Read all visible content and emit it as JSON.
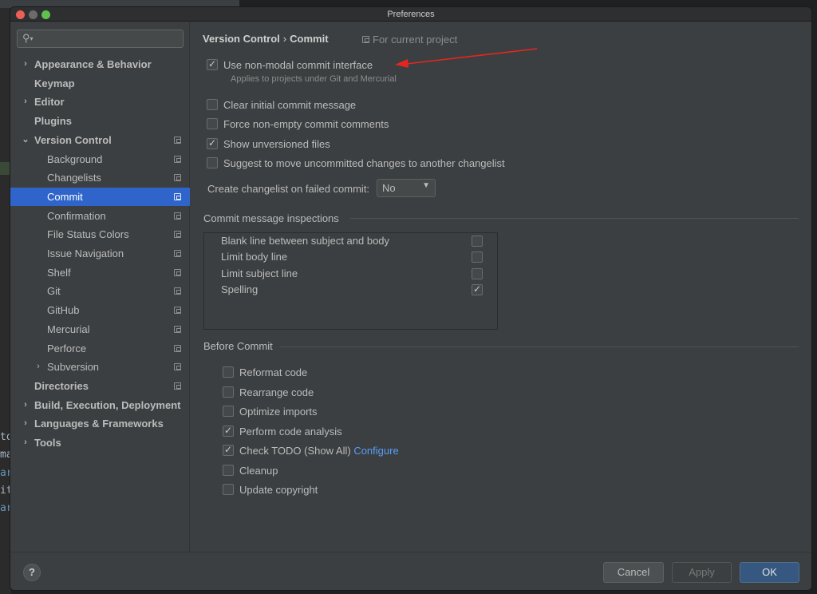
{
  "window": {
    "title": "Preferences"
  },
  "background_ide": {
    "lines": [
      {
        "text": "to",
        "blue": false
      },
      {
        "text": "ma",
        "blue": false
      },
      {
        "text": "ar",
        "blue": true
      },
      {
        "text": "it",
        "blue": false
      },
      {
        "text": "ar",
        "blue": true
      }
    ]
  },
  "sidebar": {
    "search_placeholder": "",
    "items": [
      {
        "label": "Appearance & Behavior",
        "bold": true,
        "arrow": "›",
        "indent": 0,
        "project_icon": false
      },
      {
        "label": "Keymap",
        "bold": true,
        "arrow": "",
        "indent": 0,
        "project_icon": false
      },
      {
        "label": "Editor",
        "bold": true,
        "arrow": "›",
        "indent": 0,
        "project_icon": false
      },
      {
        "label": "Plugins",
        "bold": true,
        "arrow": "",
        "indent": 0,
        "project_icon": false
      },
      {
        "label": "Version Control",
        "bold": true,
        "arrow": "⌄",
        "indent": 0,
        "project_icon": true
      },
      {
        "label": "Background",
        "bold": false,
        "arrow": "",
        "indent": 1,
        "project_icon": true
      },
      {
        "label": "Changelists",
        "bold": false,
        "arrow": "",
        "indent": 1,
        "project_icon": true
      },
      {
        "label": "Commit",
        "bold": false,
        "arrow": "",
        "indent": 1,
        "project_icon": true,
        "selected": true
      },
      {
        "label": "Confirmation",
        "bold": false,
        "arrow": "",
        "indent": 1,
        "project_icon": true
      },
      {
        "label": "File Status Colors",
        "bold": false,
        "arrow": "",
        "indent": 1,
        "project_icon": true
      },
      {
        "label": "Issue Navigation",
        "bold": false,
        "arrow": "",
        "indent": 1,
        "project_icon": true
      },
      {
        "label": "Shelf",
        "bold": false,
        "arrow": "",
        "indent": 1,
        "project_icon": true
      },
      {
        "label": "Git",
        "bold": false,
        "arrow": "",
        "indent": 1,
        "project_icon": true
      },
      {
        "label": "GitHub",
        "bold": false,
        "arrow": "",
        "indent": 1,
        "project_icon": true
      },
      {
        "label": "Mercurial",
        "bold": false,
        "arrow": "",
        "indent": 1,
        "project_icon": true
      },
      {
        "label": "Perforce",
        "bold": false,
        "arrow": "",
        "indent": 1,
        "project_icon": true
      },
      {
        "label": "Subversion",
        "bold": false,
        "arrow": "›",
        "indent": 1,
        "project_icon": true
      },
      {
        "label": "Directories",
        "bold": true,
        "arrow": "",
        "indent": 0,
        "project_icon": true
      },
      {
        "label": "Build, Execution, Deployment",
        "bold": true,
        "arrow": "›",
        "indent": 0,
        "project_icon": false
      },
      {
        "label": "Languages & Frameworks",
        "bold": true,
        "arrow": "›",
        "indent": 0,
        "project_icon": false
      },
      {
        "label": "Tools",
        "bold": true,
        "arrow": "›",
        "indent": 0,
        "project_icon": false
      }
    ]
  },
  "breadcrumb": {
    "parent": "Version Control",
    "separator": "›",
    "current": "Commit"
  },
  "scope_label": "For current project",
  "options": {
    "non_modal": {
      "label": "Use non-modal commit interface",
      "checked": true,
      "hint": "Applies to projects under Git and Mercurial"
    },
    "clear_initial": {
      "label": "Clear initial commit message",
      "checked": false
    },
    "force_nonempty": {
      "label": "Force non-empty commit comments",
      "checked": false
    },
    "show_unversioned": {
      "label": "Show unversioned files",
      "checked": true
    },
    "suggest_move": {
      "label": "Suggest to move uncommitted changes to another changelist",
      "checked": false
    }
  },
  "failed_commit": {
    "label": "Create changelist on failed commit:",
    "value": "No"
  },
  "inspections": {
    "title": "Commit message inspections",
    "items": [
      {
        "label": "Blank line between subject and body",
        "checked": false
      },
      {
        "label": "Limit body line",
        "checked": false
      },
      {
        "label": "Limit subject line",
        "checked": false
      },
      {
        "label": "Spelling",
        "checked": true
      }
    ]
  },
  "before_commit": {
    "title": "Before Commit",
    "items": [
      {
        "label": "Reformat code",
        "checked": false
      },
      {
        "label": "Rearrange code",
        "checked": false
      },
      {
        "label": "Optimize imports",
        "checked": false
      },
      {
        "label": "Perform code analysis",
        "checked": true
      },
      {
        "label": "Check TODO (Show All)",
        "checked": true,
        "link": "Configure"
      },
      {
        "label": "Cleanup",
        "checked": false
      },
      {
        "label": "Update copyright",
        "checked": false
      }
    ]
  },
  "buttons": {
    "help": "?",
    "cancel": "Cancel",
    "apply": "Apply",
    "ok": "OK"
  },
  "colors": {
    "selection": "#2f65ca",
    "link": "#589df6",
    "annotation_arrow": "#e5261f",
    "ok_button": "#365880"
  }
}
